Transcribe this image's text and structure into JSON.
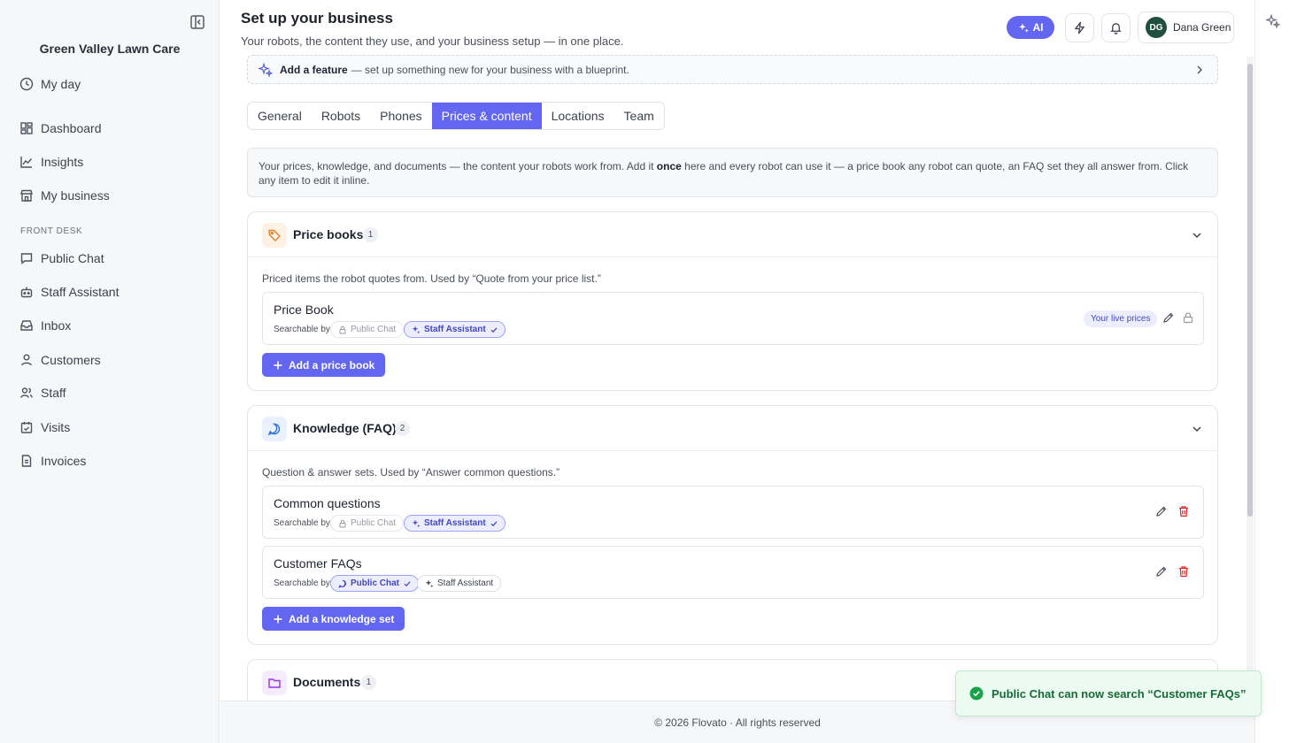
{
  "sidebar": {
    "brand": "Green Valley Lawn Care",
    "my_day": "My day",
    "items": [
      {
        "label": "Dashboard",
        "icon": "dashboard-icon"
      },
      {
        "label": "Insights",
        "icon": "chart-line-icon"
      },
      {
        "label": "My business",
        "icon": "store-icon"
      }
    ],
    "section_label": "FRONT DESK",
    "front_desk": [
      {
        "label": "Public Chat",
        "icon": "chat-icon"
      },
      {
        "label": "Staff Assistant",
        "icon": "robot-icon"
      },
      {
        "label": "Inbox",
        "icon": "inbox-icon"
      },
      {
        "label": "Customers",
        "icon": "user-icon"
      },
      {
        "label": "Staff",
        "icon": "users-icon"
      },
      {
        "label": "Visits",
        "icon": "calendar-check-icon"
      },
      {
        "label": "Invoices",
        "icon": "invoice-icon"
      }
    ]
  },
  "header": {
    "title": "Set up your business",
    "subtitle": "Your robots, the content they use, and your business setup — in one place.",
    "ai_label": "AI",
    "user": {
      "initials": "DG",
      "name": "Dana Green"
    }
  },
  "feature_banner": {
    "bold": "Add a feature",
    "text": "— set up something new for your business with a blueprint."
  },
  "tabs": [
    "General",
    "Robots",
    "Phones",
    "Prices & content",
    "Locations",
    "Team"
  ],
  "active_tab": "Prices & content",
  "info": {
    "part1": "Your prices, knowledge, and documents — the content your robots work from. Add it ",
    "bold": "once",
    "part2": " here and every robot can use it — a price book any robot can quote, an FAQ set they all answer from. Click any item to edit it inline."
  },
  "price_books": {
    "title": "Price books",
    "count": "1",
    "desc": "Priced items the robot quotes from. Used by “Quote from your price list.”",
    "searchable_label": "Searchable by",
    "items": [
      {
        "name": "Price Book",
        "chip_public": "Public Chat",
        "chip_staff": "Staff Assistant",
        "badge": "Your live prices"
      }
    ],
    "add_label": "Add a price book"
  },
  "knowledge": {
    "title": "Knowledge (FAQ)",
    "count": "2",
    "desc": "Question & answer sets. Used by “Answer common questions.”",
    "searchable_label": "Searchable by",
    "items": [
      {
        "name": "Common questions",
        "chip_public": "Public Chat",
        "chip_staff": "Staff Assistant"
      },
      {
        "name": "Customer FAQs",
        "chip_public": "Public Chat",
        "chip_staff": "Staff Assistant"
      }
    ],
    "add_label": "Add a knowledge set"
  },
  "documents": {
    "title": "Documents",
    "count": "1"
  },
  "footer": "© 2026 Flovato · All rights reserved",
  "toast": "Public Chat can now search “Customer FAQs”",
  "colors": {
    "accent": "#6366f1",
    "success": "#16a34a",
    "danger": "#dc2626",
    "avatar": "#1f4f3f"
  }
}
